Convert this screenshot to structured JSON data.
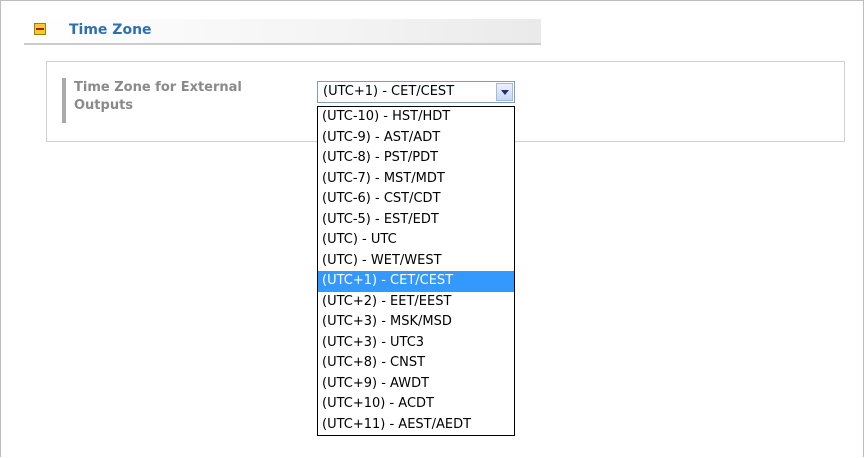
{
  "section": {
    "title": "Time Zone"
  },
  "field": {
    "label": "Time Zone for External Outputs",
    "selected_value": "(UTC+1) - CET/CEST"
  },
  "dropdown": {
    "options": [
      "(UTC-10) - HST/HDT",
      "(UTC-9) - AST/ADT",
      "(UTC-8) - PST/PDT",
      "(UTC-7) - MST/MDT",
      "(UTC-6) - CST/CDT",
      "(UTC-5) - EST/EDT",
      "(UTC) - UTC",
      "(UTC) - WET/WEST",
      "(UTC+1) - CET/CEST",
      "(UTC+2) - EET/EEST",
      "(UTC+3) - MSK/MSD",
      "(UTC+3) - UTC3",
      "(UTC+8) - CNST",
      "(UTC+9) - AWDT",
      "(UTC+10) - ACDT",
      "(UTC+11) - AEST/AEDT"
    ],
    "highlighted": "(UTC+1) - CET/CEST"
  },
  "colors": {
    "section_title": "#2e6fb0",
    "highlight": "#3399ff",
    "collapse_icon": "#f2cd2a"
  }
}
